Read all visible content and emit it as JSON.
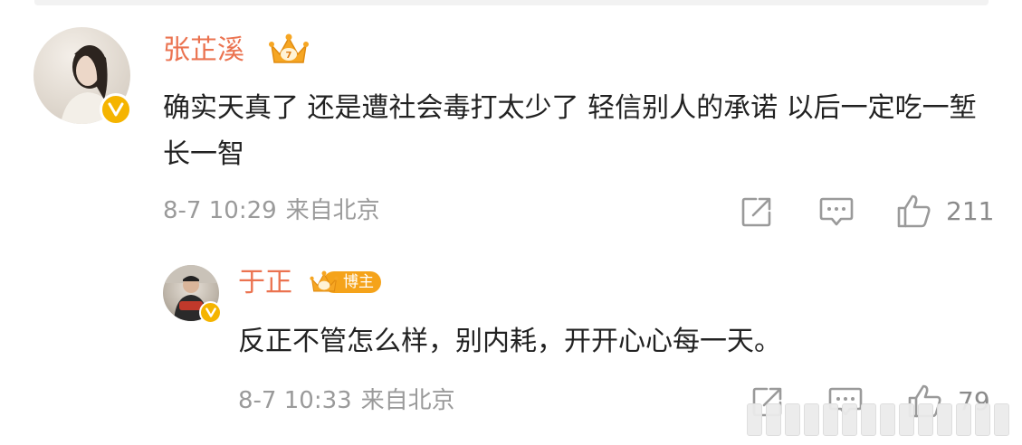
{
  "comment": {
    "author": "张芷溪",
    "text": "确实天真了 还是遭社会毒打太少了 轻信别人的承诺 以后一定吃一堑长一智",
    "time": "8-7 10:29",
    "location": "来自北京",
    "likes": "211"
  },
  "reply": {
    "author": "于正",
    "badge": "博主",
    "text": "反正不管怎么样，别内耗，开开心心每一天。",
    "time": "8-7 10:33",
    "location": "来自北京",
    "likes": "79"
  },
  "colors": {
    "name": "#eb7350",
    "verified": "#f5b400",
    "badge": "#f5a31a",
    "meta": "#9a9a9a"
  },
  "icons": [
    "share-icon",
    "comment-icon",
    "like-icon",
    "crown-icon",
    "verified-icon"
  ]
}
